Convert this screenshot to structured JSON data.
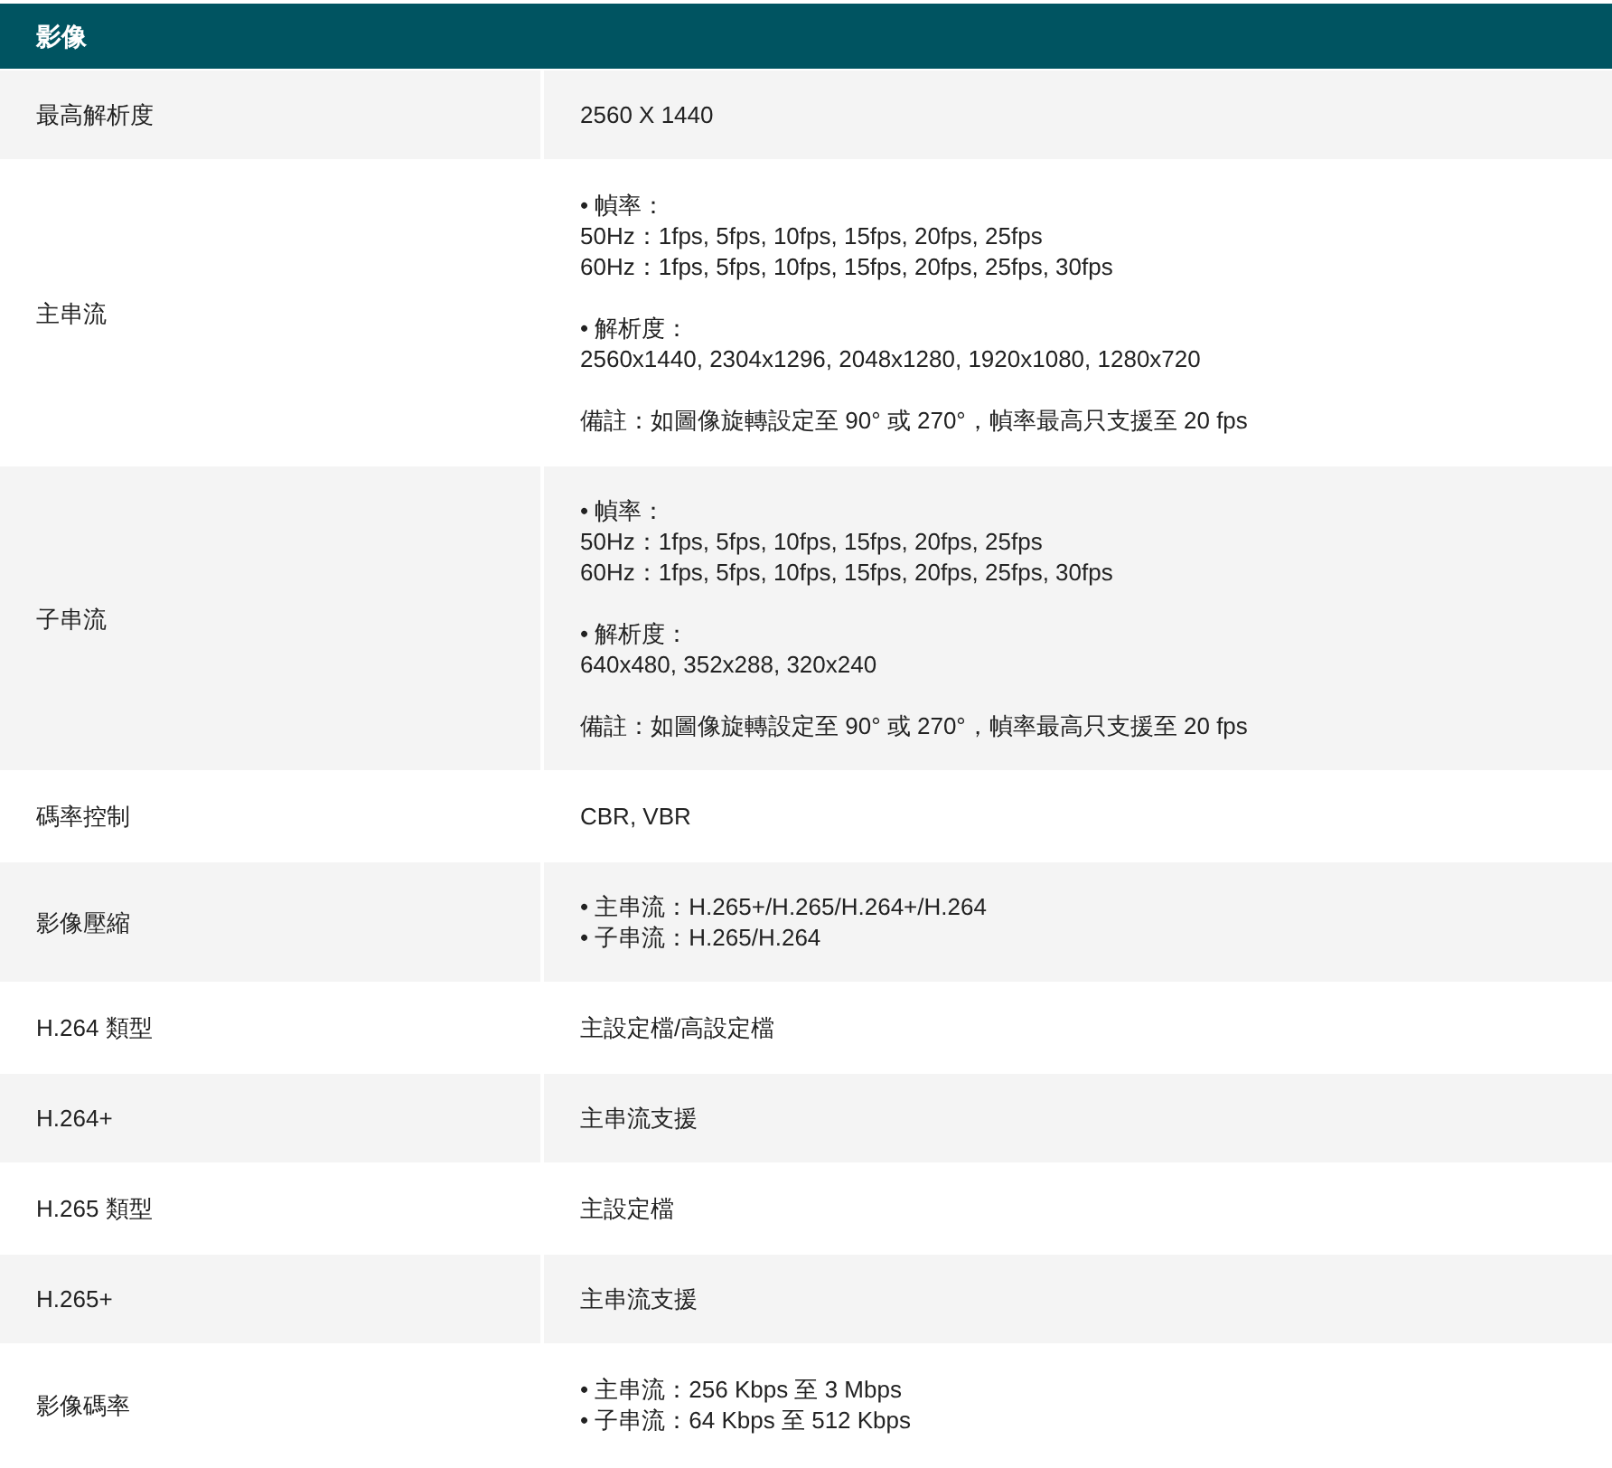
{
  "section": {
    "title": "影像"
  },
  "rows": [
    {
      "label": "最高解析度",
      "paragraphs": [
        [
          "2560 X 1440"
        ]
      ]
    },
    {
      "label": "主串流",
      "paragraphs": [
        [
          "• 幀率：",
          "50Hz：1fps, 5fps, 10fps, 15fps, 20fps, 25fps",
          "60Hz：1fps, 5fps, 10fps, 15fps, 20fps, 25fps, 30fps"
        ],
        [
          "• 解析度：",
          "2560x1440, 2304x1296, 2048x1280, 1920x1080, 1280x720"
        ],
        [
          "備註：如圖像旋轉設定至 90° 或 270°，幀率最高只支援至 20 fps"
        ]
      ]
    },
    {
      "label": "子串流",
      "paragraphs": [
        [
          "• 幀率：",
          "50Hz：1fps, 5fps, 10fps, 15fps, 20fps, 25fps",
          "60Hz：1fps, 5fps, 10fps, 15fps, 20fps, 25fps, 30fps"
        ],
        [
          "• 解析度：",
          "640x480, 352x288, 320x240"
        ],
        [
          "備註：如圖像旋轉設定至 90° 或 270°，幀率最高只支援至 20 fps"
        ]
      ]
    },
    {
      "label": "碼率控制",
      "paragraphs": [
        [
          "CBR, VBR"
        ]
      ]
    },
    {
      "label": "影像壓縮",
      "paragraphs": [
        [
          "• 主串流：H.265+/H.265/H.264+/H.264",
          "• 子串流：H.265/H.264"
        ]
      ]
    },
    {
      "label": "H.264 類型",
      "paragraphs": [
        [
          "主設定檔/高設定檔"
        ]
      ]
    },
    {
      "label": "H.264+",
      "paragraphs": [
        [
          "主串流支援"
        ]
      ]
    },
    {
      "label": "H.265 類型",
      "paragraphs": [
        [
          "主設定檔"
        ]
      ]
    },
    {
      "label": "H.265+",
      "paragraphs": [
        [
          "主串流支援"
        ]
      ]
    },
    {
      "label": "影像碼率",
      "paragraphs": [
        [
          "• 主串流：256 Kbps 至 3 Mbps",
          "• 子串流：64 Kbps 至 512 Kbps"
        ]
      ]
    }
  ]
}
